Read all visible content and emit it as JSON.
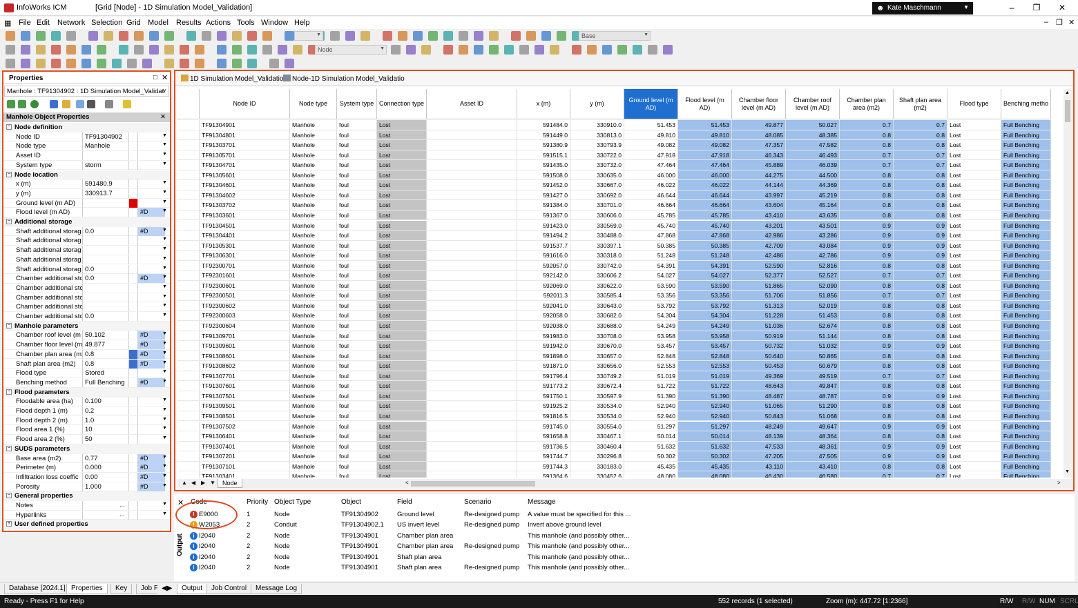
{
  "window": {
    "app": "InfoWorks ICM",
    "doc_title": "[Grid [Node] - 1D Simulation Model_Validation]",
    "user": "Kate Maschmann"
  },
  "menu": [
    "File",
    "Edit",
    "Network",
    "Selection",
    "Grid",
    "Model",
    "Results",
    "Actions",
    "Tools",
    "Window",
    "Help"
  ],
  "toolbar": {
    "scenario_combo": "Base",
    "node_combo": "Node"
  },
  "properties": {
    "title": "Properties",
    "object_selector": "Manhole : TF91304902 : 1D Simulation Model_Validat",
    "grid_title": "Manhole Object Properties",
    "sections": [
      {
        "name": "Node definition",
        "rows": [
          {
            "label": "Node ID",
            "value": "TF91304902",
            "fv": ""
          },
          {
            "label": "Node type",
            "value": "Manhole",
            "fv": ""
          },
          {
            "label": "Asset ID",
            "value": "",
            "fv": ""
          },
          {
            "label": "System type",
            "value": "storm",
            "fv": ""
          }
        ]
      },
      {
        "name": "Node location",
        "rows": [
          {
            "label": "x (m)",
            "value": "591480.9",
            "fv": ""
          },
          {
            "label": "y (m)",
            "value": "330913.7",
            "fv": ""
          },
          {
            "label": "Ground level (m AD)",
            "value": "",
            "fv": "",
            "flag": "red"
          },
          {
            "label": "Flood level (m AD)",
            "value": "",
            "fv": "#D"
          }
        ]
      },
      {
        "name": "Additional storage",
        "rows": [
          {
            "label": "Shaft additional storag",
            "value": "0.0",
            "fv": "#D"
          },
          {
            "label": "Shaft additional storag",
            "value": "",
            "fv": ""
          },
          {
            "label": "Shaft additional storag",
            "value": "",
            "fv": ""
          },
          {
            "label": "Shaft additional storag",
            "value": "",
            "fv": ""
          },
          {
            "label": "Shaft additional storag",
            "value": "0.0",
            "fv": ""
          },
          {
            "label": "Chamber additional sto",
            "value": "0.0",
            "fv": "#D"
          },
          {
            "label": "Chamber additional sto",
            "value": "",
            "fv": ""
          },
          {
            "label": "Chamber additional sto",
            "value": "",
            "fv": ""
          },
          {
            "label": "Chamber additional sto",
            "value": "",
            "fv": ""
          },
          {
            "label": "Chamber additional sto",
            "value": "0.0",
            "fv": ""
          }
        ]
      },
      {
        "name": "Manhole parameters",
        "rows": [
          {
            "label": "Chamber roof level (m A",
            "value": "50.102",
            "fv": "#D"
          },
          {
            "label": "Chamber floor level (m",
            "value": "49.877",
            "fv": "#D"
          },
          {
            "label": "Chamber plan area (m2",
            "value": "0.8",
            "fv": "#D",
            "flag": "blue"
          },
          {
            "label": "Shaft plan area (m2)",
            "value": "0.8",
            "fv": "#D",
            "flag": "blue"
          },
          {
            "label": "Flood type",
            "value": "Stored",
            "fv": ""
          },
          {
            "label": "Benching method",
            "value": "Full Benching",
            "fv": "#D"
          }
        ]
      },
      {
        "name": "Flood parameters",
        "rows": [
          {
            "label": "Floodable area (ha)",
            "value": "0.100",
            "fv": ""
          },
          {
            "label": "Flood depth 1 (m)",
            "value": "0.2",
            "fv": ""
          },
          {
            "label": "Flood depth 2 (m)",
            "value": "1.0",
            "fv": ""
          },
          {
            "label": "Flood area 1 (%)",
            "value": "10",
            "fv": ""
          },
          {
            "label": "Flood area 2 (%)",
            "value": "50",
            "fv": ""
          }
        ]
      },
      {
        "name": "SUDS parameters",
        "rows": [
          {
            "label": "Base area (m2)",
            "value": "0.77",
            "fv": "#D"
          },
          {
            "label": "Perimeter (m)",
            "value": "0.000",
            "fv": "#D"
          },
          {
            "label": "Infiltration loss coeffic",
            "value": "0.00",
            "fv": "#D"
          },
          {
            "label": "Porosity",
            "value": "1.000",
            "fv": "#D"
          }
        ]
      },
      {
        "name": "General properties",
        "rows": [
          {
            "label": "Notes",
            "value": "",
            "fv": "",
            "ell": true
          },
          {
            "label": "Hyperlinks",
            "value": "",
            "fv": "",
            "ell": true
          }
        ]
      },
      {
        "name": "User defined properties",
        "rows": [],
        "collapsed": true
      }
    ]
  },
  "grid": {
    "tab1": "1D Simulation Model_Validatior",
    "tab2": "Node-1D Simulation Model_Validatio",
    "columns": [
      "Node ID",
      "Node type",
      "System type",
      "Connection type",
      "Asset ID",
      "x (m)",
      "y (m)",
      "Ground level (m AD)",
      "Flood level (m AD)",
      "Chamber floor level (m AD)",
      "Chamber roof level (m AD)",
      "Chamber plan area (m2)",
      "Shaft plan area (m2)",
      "Flood type",
      "Benching metho"
    ],
    "rows": [
      [
        "TF91304901",
        "Manhole",
        "foul",
        "Lost",
        "",
        "591484.0",
        "330910.0",
        "51.453",
        "51.453",
        "49.877",
        "50.027",
        "0.7",
        "0.7",
        "Lost",
        "Full Benching"
      ],
      [
        "TF91304801",
        "Manhole",
        "foul",
        "Lost",
        "",
        "591449.0",
        "330813.0",
        "49.810",
        "49.810",
        "48.085",
        "48.385",
        "0.8",
        "0.8",
        "Lost",
        "Full Benching"
      ],
      [
        "TF91303701",
        "Manhole",
        "foul",
        "Lost",
        "",
        "591380.9",
        "330793.9",
        "49.082",
        "49.082",
        "47.357",
        "47.582",
        "0.8",
        "0.8",
        "Lost",
        "Full Benching"
      ],
      [
        "TF91305701",
        "Manhole",
        "foul",
        "Lost",
        "",
        "591515.1",
        "330722.0",
        "47.918",
        "47.918",
        "46.343",
        "46.493",
        "0.7",
        "0.7",
        "Lost",
        "Full Benching"
      ],
      [
        "TF91304701",
        "Manhole",
        "foul",
        "Lost",
        "",
        "591435.0",
        "330732.0",
        "47.464",
        "47.464",
        "45.889",
        "46.039",
        "0.7",
        "0.7",
        "Lost",
        "Full Benching"
      ],
      [
        "TF91305601",
        "Manhole",
        "foul",
        "Lost",
        "",
        "591508.0",
        "330635.0",
        "46.000",
        "46.000",
        "44.275",
        "44.500",
        "0.8",
        "0.8",
        "Lost",
        "Full Benching"
      ],
      [
        "TF91304601",
        "Manhole",
        "foul",
        "Lost",
        "",
        "591452.0",
        "330667.0",
        "46.022",
        "46.022",
        "44.144",
        "44.369",
        "0.8",
        "0.8",
        "Lost",
        "Full Benching"
      ],
      [
        "TF91304602",
        "Manhole",
        "foul",
        "Lost",
        "",
        "591427.0",
        "330692.0",
        "46.644",
        "46.644",
        "43.997",
        "45.219",
        "0.8",
        "0.8",
        "Lost",
        "Full Benching"
      ],
      [
        "TF91303702",
        "Manhole",
        "foul",
        "Lost",
        "",
        "591384.0",
        "330701.0",
        "46.664",
        "46.664",
        "43.604",
        "45.164",
        "0.8",
        "0.8",
        "Lost",
        "Full Benching"
      ],
      [
        "TF91303601",
        "Manhole",
        "foul",
        "Lost",
        "",
        "591367.0",
        "330606.0",
        "45.785",
        "45.785",
        "43.410",
        "43.635",
        "0.8",
        "0.8",
        "Lost",
        "Full Benching"
      ],
      [
        "TF91304501",
        "Manhole",
        "foul",
        "Lost",
        "",
        "591423.0",
        "330569.0",
        "45.740",
        "45.740",
        "43.201",
        "43.501",
        "0.9",
        "0.9",
        "Lost",
        "Full Benching"
      ],
      [
        "TF91304401",
        "Manhole",
        "foul",
        "Lost",
        "",
        "591494.2",
        "330488.0",
        "47.868",
        "47.868",
        "42.986",
        "43.286",
        "0.9",
        "0.9",
        "Lost",
        "Full Benching"
      ],
      [
        "TF91305301",
        "Manhole",
        "foul",
        "Lost",
        "",
        "591537.7",
        "330397.1",
        "50.385",
        "50.385",
        "42.709",
        "43.084",
        "0.9",
        "0.9",
        "Lost",
        "Full Benching"
      ],
      [
        "TF91306301",
        "Manhole",
        "foul",
        "Lost",
        "",
        "591616.0",
        "330318.0",
        "51.248",
        "51.248",
        "42.486",
        "42.786",
        "0.9",
        "0.9",
        "Lost",
        "Full Benching"
      ],
      [
        "TF92300701",
        "Manhole",
        "foul",
        "Lost",
        "",
        "592057.0",
        "330742.0",
        "54.391",
        "54.391",
        "52.590",
        "52.816",
        "0.8",
        "0.8",
        "Lost",
        "Full Benching"
      ],
      [
        "TF92301601",
        "Manhole",
        "foul",
        "Lost",
        "",
        "592142.0",
        "330606.2",
        "54.027",
        "54.027",
        "52.377",
        "52.527",
        "0.7",
        "0.7",
        "Lost",
        "Full Benching"
      ],
      [
        "TF92300601",
        "Manhole",
        "foul",
        "Lost",
        "",
        "592069.0",
        "330622.0",
        "53.590",
        "53.590",
        "51.865",
        "52.090",
        "0.8",
        "0.8",
        "Lost",
        "Full Benching"
      ],
      [
        "TF92300501",
        "Manhole",
        "foul",
        "Lost",
        "",
        "592011.3",
        "330585.4",
        "53.356",
        "53.356",
        "51.706",
        "51.856",
        "0.7",
        "0.7",
        "Lost",
        "Full Benching"
      ],
      [
        "TF92300602",
        "Manhole",
        "foul",
        "Lost",
        "",
        "592041.0",
        "330643.0",
        "53.792",
        "53.792",
        "51.313",
        "52.019",
        "0.8",
        "0.8",
        "Lost",
        "Full Benching"
      ],
      [
        "TF92300603",
        "Manhole",
        "foul",
        "Lost",
        "",
        "592058.0",
        "330682.0",
        "54.304",
        "54.304",
        "51.228",
        "51.453",
        "0.8",
        "0.8",
        "Lost",
        "Full Benching"
      ],
      [
        "TF92300604",
        "Manhole",
        "foul",
        "Lost",
        "",
        "592038.0",
        "330688.0",
        "54.249",
        "54.249",
        "51.036",
        "52.674",
        "0.8",
        "0.8",
        "Lost",
        "Full Benching"
      ],
      [
        "TF91309701",
        "Manhole",
        "foul",
        "Lost",
        "",
        "591983.0",
        "330708.0",
        "53.958",
        "53.958",
        "50.919",
        "51.144",
        "0.8",
        "0.8",
        "Lost",
        "Full Benching"
      ],
      [
        "TF91309601",
        "Manhole",
        "foul",
        "Lost",
        "",
        "591942.0",
        "330670.0",
        "53.457",
        "53.457",
        "50.732",
        "51.032",
        "0.9",
        "0.9",
        "Lost",
        "Full Benching"
      ],
      [
        "TF91308601",
        "Manhole",
        "foul",
        "Lost",
        "",
        "591898.0",
        "330657.0",
        "52.848",
        "52.848",
        "50.640",
        "50.865",
        "0.8",
        "0.8",
        "Lost",
        "Full Benching"
      ],
      [
        "TF91308602",
        "Manhole",
        "foul",
        "Lost",
        "",
        "591871.0",
        "330656.0",
        "52.553",
        "52.553",
        "50.453",
        "50.679",
        "0.8",
        "0.8",
        "Lost",
        "Full Benching"
      ],
      [
        "TF91307701",
        "Manhole",
        "foul",
        "Lost",
        "",
        "591796.4",
        "330749.2",
        "51.019",
        "51.019",
        "49.369",
        "49.519",
        "0.7",
        "0.7",
        "Lost",
        "Full Benching"
      ],
      [
        "TF91307601",
        "Manhole",
        "foul",
        "Lost",
        "",
        "591773.2",
        "330672.4",
        "51.722",
        "51.722",
        "48.643",
        "49.847",
        "0.8",
        "0.8",
        "Lost",
        "Full Benching"
      ],
      [
        "TF91307501",
        "Manhole",
        "foul",
        "Lost",
        "",
        "591750.1",
        "330597.9",
        "51.390",
        "51.390",
        "48.487",
        "48.787",
        "0.9",
        "0.9",
        "Lost",
        "Full Benching"
      ],
      [
        "TF91309501",
        "Manhole",
        "foul",
        "Lost",
        "",
        "591925.2",
        "330534.0",
        "52.940",
        "52.940",
        "51.065",
        "51.290",
        "0.8",
        "0.8",
        "Lost",
        "Full Benching"
      ],
      [
        "TF91308501",
        "Manhole",
        "foul",
        "Lost",
        "",
        "591816.5",
        "330534.0",
        "52.940",
        "52.940",
        "50.843",
        "51.068",
        "0.8",
        "0.8",
        "Lost",
        "Full Benching"
      ],
      [
        "TF91307502",
        "Manhole",
        "foul",
        "Lost",
        "",
        "591745.0",
        "330554.0",
        "51.297",
        "51.297",
        "48.249",
        "49.647",
        "0.9",
        "0.9",
        "Lost",
        "Full Benching"
      ],
      [
        "TF91306401",
        "Manhole",
        "foul",
        "Lost",
        "",
        "591658.8",
        "330467.1",
        "50.014",
        "50.014",
        "48.139",
        "48.364",
        "0.8",
        "0.8",
        "Lost",
        "Full Benching"
      ],
      [
        "TF91307401",
        "Manhole",
        "foul",
        "Lost",
        "",
        "591736.5",
        "330460.4",
        "51.632",
        "51.632",
        "47.533",
        "48.361",
        "0.9",
        "0.9",
        "Lost",
        "Full Benching"
      ],
      [
        "TF91307201",
        "Manhole",
        "foul",
        "Lost",
        "",
        "591744.7",
        "330296.8",
        "50.302",
        "50.302",
        "47.205",
        "47.505",
        "0.9",
        "0.9",
        "Lost",
        "Full Benching"
      ],
      [
        "TF91307101",
        "Manhole",
        "foul",
        "Lost",
        "",
        "591744.3",
        "330183.0",
        "45.435",
        "45.435",
        "43.110",
        "43.410",
        "0.8",
        "0.8",
        "Lost",
        "Full Benching"
      ],
      [
        "TF91303401",
        "Manhole",
        "foul",
        "Lost",
        "",
        "591364.6",
        "330452.6",
        "48.080",
        "48.080",
        "46.430",
        "46.580",
        "0.7",
        "0.7",
        "Lost",
        "Full Benching"
      ]
    ],
    "sheet_tab": "Node"
  },
  "output": {
    "vertical_label": "Output",
    "headers": [
      "Code",
      "Priority",
      "Object Type",
      "Object",
      "Field",
      "Scenario",
      "Message"
    ],
    "rows": [
      {
        "icon": "error",
        "code": "E9000",
        "priority": "1",
        "type": "Node",
        "object": "TF91304902",
        "field": "Ground level",
        "scenario": "Re-designed pump",
        "message": "A value must be specified for this ..."
      },
      {
        "icon": "warning",
        "code": "W2053",
        "priority": "2",
        "type": "Conduit",
        "object": "TF91304902.1",
        "field": "US invert level",
        "scenario": "Re-designed pump",
        "message": "Invert above ground level"
      },
      {
        "icon": "info",
        "code": "I2040",
        "priority": "2",
        "type": "Node",
        "object": "TF91304901",
        "field": "Chamber plan area",
        "scenario": "",
        "message": "This manhole (and possibly other..."
      },
      {
        "icon": "info",
        "code": "I2040",
        "priority": "2",
        "type": "Node",
        "object": "TF91304901",
        "field": "Chamber plan area",
        "scenario": "Re-designed pump",
        "message": "This manhole (and possibly other..."
      },
      {
        "icon": "info",
        "code": "I2040",
        "priority": "2",
        "type": "Node",
        "object": "TF91304901",
        "field": "Shaft plan area",
        "scenario": "",
        "message": "This manhole (and possibly other..."
      },
      {
        "icon": "info",
        "code": "I2040",
        "priority": "2",
        "type": "Node",
        "object": "TF91304901",
        "field": "Shaft plan area",
        "scenario": "Re-designed pump",
        "message": "This manhole (and possibly other..."
      }
    ]
  },
  "bottom_tabs": [
    "Database [2024.1]",
    "Properties",
    "Key",
    "Job F",
    "Output",
    "Job Control",
    "Message Log"
  ],
  "status": {
    "left": "Ready - Press F1 for Help",
    "records": "552 records (1 selected)",
    "zoom": "Zoom (m): 447.72 [1:2366]",
    "rw": "R/W",
    "rw2": "R/W",
    "num": "NUM",
    "scrl": "SCRL"
  },
  "colors": {
    "accent_border": "#e05020",
    "selected_header": "#1f6fd1",
    "flood_col": "#9ec0ea",
    "conn_col": "#c4c4c4"
  }
}
